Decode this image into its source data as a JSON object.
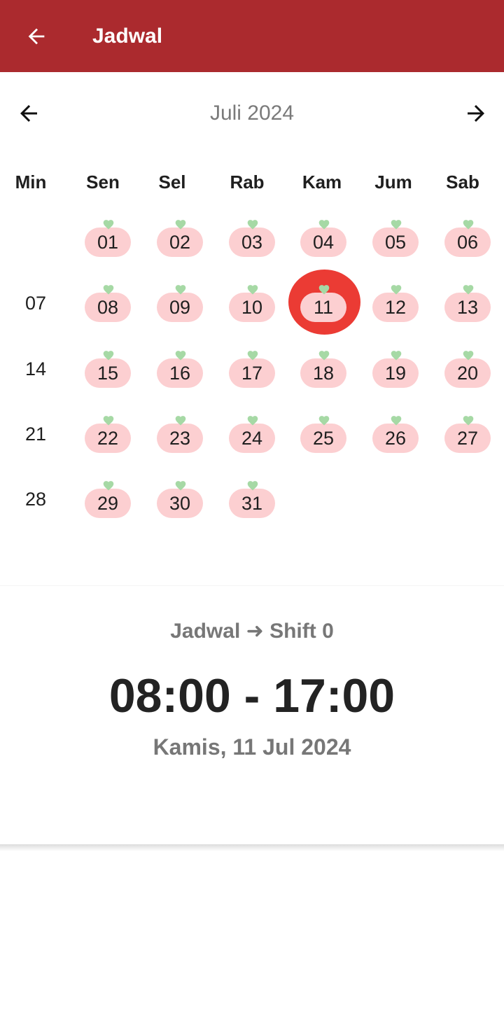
{
  "appbar": {
    "title": "Jadwal",
    "background_color": "#ab2a2e",
    "back_icon": "arrow-left-icon"
  },
  "calendar": {
    "month_label": "Juli 2024",
    "prev_icon": "arrow-left-icon",
    "next_icon": "arrow-right-icon",
    "weekdays": [
      "Min",
      "Sen",
      "Sel",
      "Rab",
      "Kam",
      "Jum",
      "Sab"
    ],
    "weeks": [
      [
        "",
        "01",
        "02",
        "03",
        "04",
        "05",
        "06"
      ],
      [
        "07",
        "08",
        "09",
        "10",
        "11",
        "12",
        "13"
      ],
      [
        "14",
        "15",
        "16",
        "17",
        "18",
        "19",
        "20"
      ],
      [
        "21",
        "22",
        "23",
        "24",
        "25",
        "26",
        "27"
      ],
      [
        "28",
        "29",
        "30",
        "31",
        "",
        "",
        ""
      ]
    ],
    "selected_day": "11",
    "scheduled_color": "#fccfd1",
    "marker_color": "#a6d9a5",
    "selected_color": "#eb3b34",
    "marker_icon": "heart-icon"
  },
  "schedule": {
    "label": "Jadwal ➜ Shift 0",
    "time": "08:00 - 17:00",
    "date": "Kamis, 11 Jul 2024"
  }
}
